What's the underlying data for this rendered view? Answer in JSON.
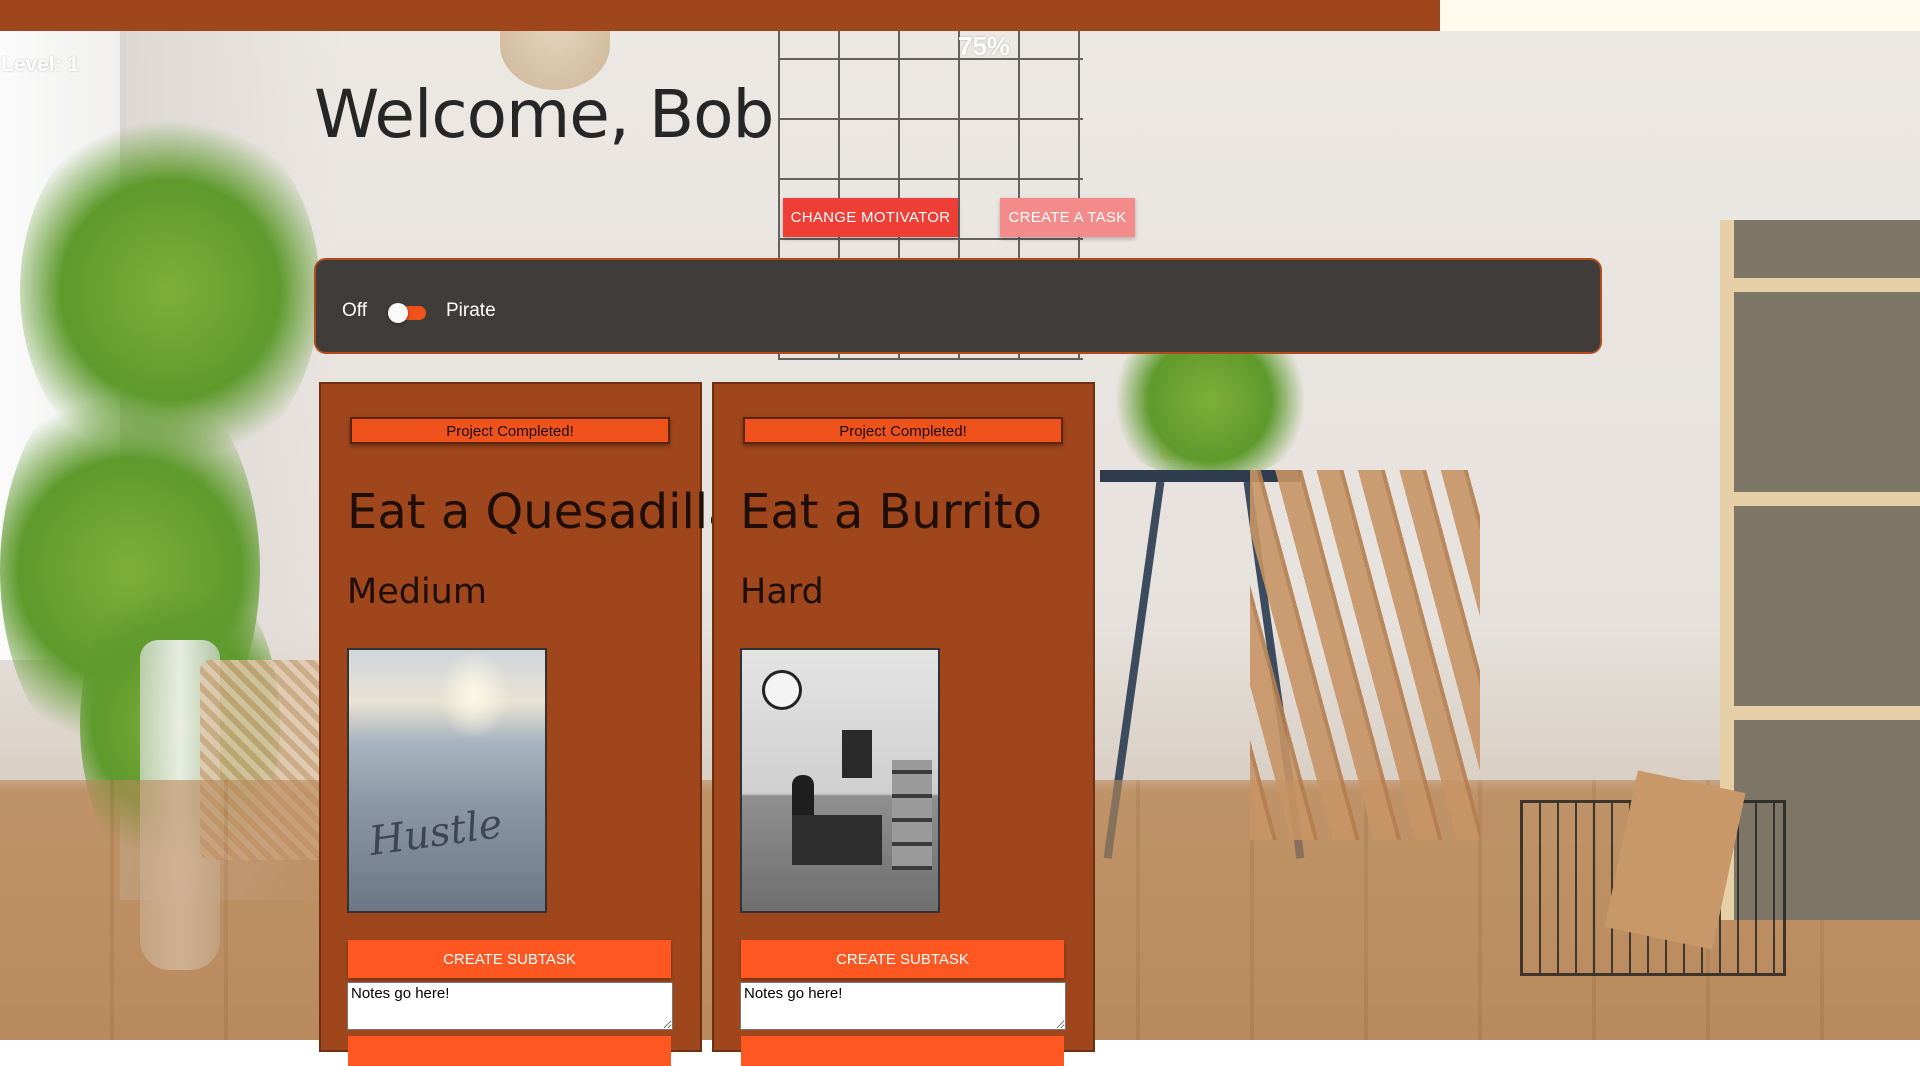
{
  "progress": {
    "percent": 0.75,
    "label": "75%",
    "fill_color": "#a0461c",
    "track_color": "#fffaeb"
  },
  "level": {
    "label": "Level: 1"
  },
  "welcome": {
    "text": "Welcome, Bob"
  },
  "toolbar": {
    "motivator_label": "CHANGE MOTIVATOR",
    "create_task_label": "CREATE A TASK"
  },
  "motivator_toggle": {
    "off_label": "Off",
    "on_label": "Pirate",
    "checked": true
  },
  "tasks": [
    {
      "status_label": "Project Completed!",
      "title": "Eat a Quesadilla",
      "difficulty": "Medium",
      "image_icon": "beach-hustle-photo",
      "subtask_label": "CREATE SUBTASK",
      "notes": "Notes go here!"
    },
    {
      "status_label": "Project Completed!",
      "title": "Eat a Burrito",
      "difficulty": "Hard",
      "image_icon": "study-room-photo",
      "subtask_label": "CREATE SUBTASK",
      "notes": "Notes go here!"
    }
  ],
  "colors": {
    "accent": "#fe5722",
    "card": "#a0461c",
    "panel": "#403c3a",
    "motivator_button": "#ef3e36",
    "create_button": "#f48b8b"
  }
}
